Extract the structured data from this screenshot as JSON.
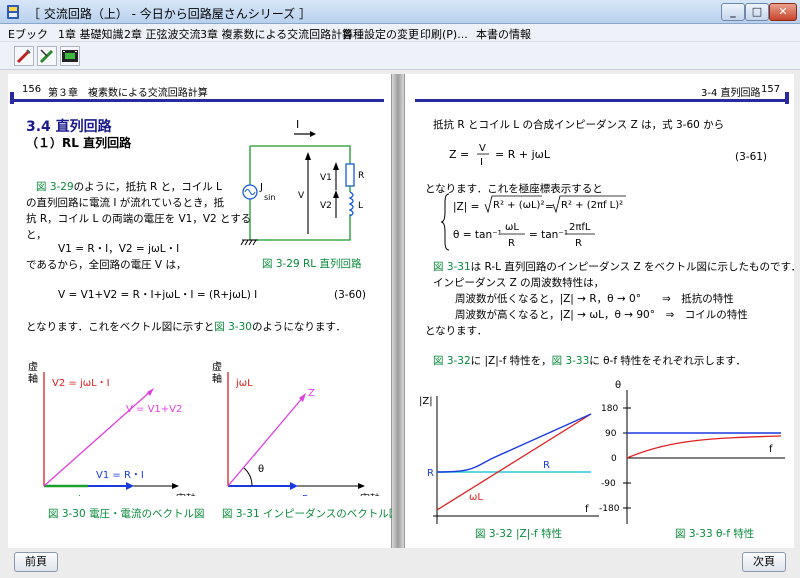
{
  "window": {
    "title": "［ 交流回路（上） - 今日から回路屋さんシリーズ ］",
    "minimize": "_",
    "maximize": "□",
    "close": "✕"
  },
  "menu": [
    {
      "label": "Eブック"
    },
    {
      "label": "1章 基礎知識"
    },
    {
      "label": "2章 正弦波交流"
    },
    {
      "label": "3章 複素数による交流回路計算"
    },
    {
      "label": "各種設定の変更"
    },
    {
      "label": "印刷(P)..."
    },
    {
      "label": "本書の情報"
    }
  ],
  "toolbar": {
    "icons": [
      "pen-icon",
      "eraser-icon",
      "film-icon"
    ]
  },
  "left_page": {
    "page_number": "156",
    "chapter": "第３章　複素数による交流回路計算",
    "section": "3.4 直列回路",
    "subsection": "（１）RL 直列回路",
    "p1_ref": "図 3-29",
    "p1_rest": "のように，抵抗 R と，コイル L",
    "p2": "の直列回路に電流 I が流れているとき，抵",
    "p3": "抗 R，コイル L の両端の電圧を V1，V2 とする",
    "p4": "と，",
    "eq1": "V1 = R・I，V2 = jωL・I",
    "p5": "であるから，全回路の電圧 V は，",
    "eq2": "V = V1+V2 = R・I+jωL・I = (R+jωL) I",
    "eq2_no": "(3-60)",
    "p6_a": "となります．これをベクトル図に示すと",
    "p6_ref": "図 3-30",
    "p6_b": "のようになります．",
    "fig29": {
      "caption": "図 3-29  RL 直列回路",
      "current": "I",
      "source": "J",
      "source_sub": "sin",
      "v1": "V1",
      "v2": "V2",
      "v": "V",
      "r": "R",
      "l": "L"
    },
    "fig30": {
      "caption": "図 3-30  電圧・電流のベクトル図",
      "yaxis": "虚\n軸",
      "xaxis": "実軸",
      "v2": "V2 = jωL・I",
      "v": "V = V1+V2",
      "v1": "V1 = R・I",
      "i": "I"
    },
    "fig31": {
      "caption": "図 3-31  インピーダンスのベクトル図",
      "yaxis": "虚\n軸",
      "xaxis": "実軸",
      "jwl": "jωL",
      "z": "Z",
      "theta": "θ",
      "r": "R"
    }
  },
  "right_page": {
    "page_number": "157",
    "header": "3-4  直列回路",
    "p1": "抵抗 R とコイル L の合成インピーダンス Z は，式 3-60 から",
    "eq1_no": "(3-61)",
    "p2": "となります．これを極座標表示すると",
    "p3_ref": "図 3-31",
    "p3_rest": "は R-L 直列回路のインピーダンス Z をベクトル図に示したものです．",
    "p4": "インピーダンス Z の周波数特性は，",
    "p5": "周波数が低くなると，|Z| → R，θ → 0°　　⇒　抵抗の特性",
    "p6": "周波数が高くなると，|Z| → ωL，θ → 90°　⇒　コイルの特性",
    "p7": "となります．",
    "p8_ref1": "図 3-32",
    "p8_mid": "に |Z|-f 特性を，",
    "p8_ref2": "図 3-33",
    "p8_rest": "に θ-f 特性をそれぞれ示します．",
    "fig32": {
      "caption": "図 3-32  |Z|-f 特性",
      "yaxis": "|Z|",
      "xaxis": "f",
      "r_left": "R",
      "r_curve": "R",
      "wl": "ωL"
    },
    "fig33": {
      "caption": "図 3-33  θ-f 特性",
      "yaxis": "θ",
      "xaxis": "f",
      "ticks": [
        "180",
        "90",
        "0",
        "-90",
        "-180"
      ]
    }
  },
  "nav": {
    "prev": "前頁",
    "next": "次頁"
  }
}
